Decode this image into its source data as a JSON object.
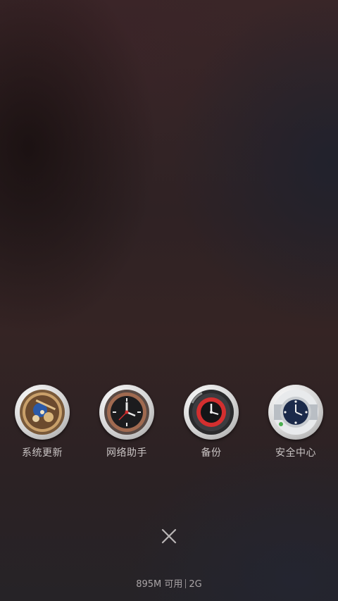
{
  "recent_apps": [
    {
      "label": "系统更新",
      "icon": "watch-skeleton-icon"
    },
    {
      "label": "网络助手",
      "icon": "watch-black-red-icon"
    },
    {
      "label": "备份",
      "icon": "watch-red-ring-icon"
    },
    {
      "label": "安全中心",
      "icon": "watch-blue-dial-icon"
    }
  ],
  "close": {
    "icon": "close-icon"
  },
  "memory": {
    "available": "895M 可用",
    "total": "2G"
  },
  "colors": {
    "label_text": "#c9c4c4",
    "status_text": "#a9a4a6",
    "background_top": "#3a2628",
    "background_bottom": "#262327"
  }
}
